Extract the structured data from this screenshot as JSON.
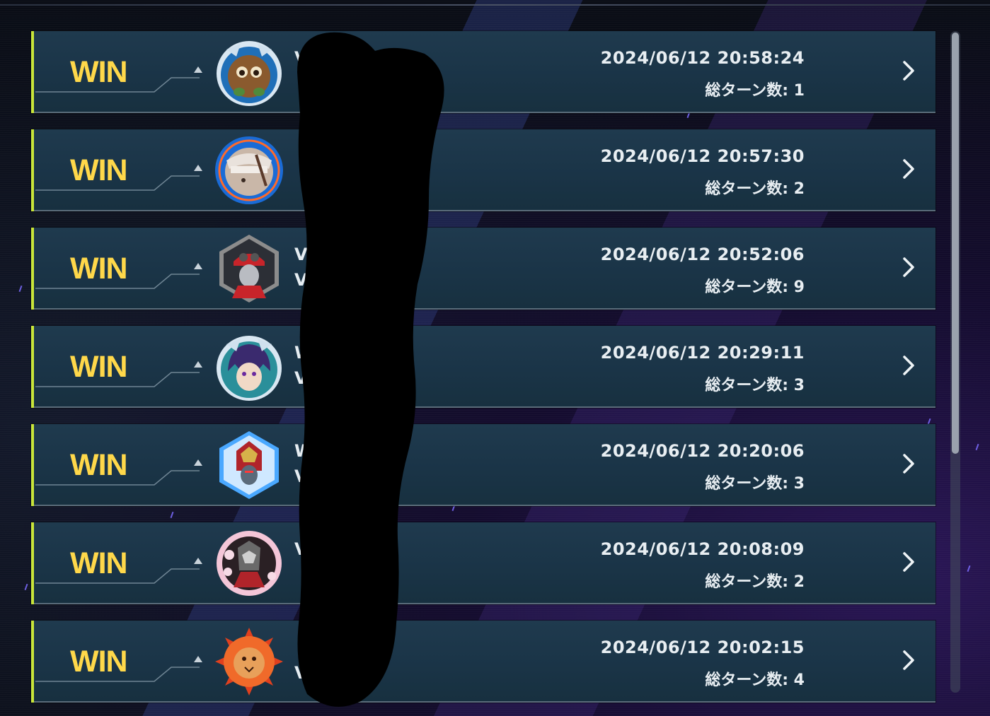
{
  "duel_history": {
    "entries": [
      {
        "result": "WIN",
        "avatar": "kuriboh-avatar",
        "name_line1": "V",
        "name_line2": "",
        "datetime": "2024/06/12 20:58:24",
        "turns": "総ターン数: 1"
      },
      {
        "result": "WIN",
        "avatar": "masked-duelist-avatar",
        "name_line1": "",
        "name_line2": "",
        "datetime": "2024/06/12 20:57:30",
        "turns": "総ターン数: 2"
      },
      {
        "result": "WIN",
        "avatar": "red-cap-duelist-avatar",
        "name_line1": "V",
        "name_line2": "V",
        "datetime": "2024/06/12 20:52:06",
        "turns": "総ターン数: 9"
      },
      {
        "result": "WIN",
        "avatar": "purple-haired-duelist-avatar",
        "name_line1": "W",
        "name_line2": "V",
        "datetime": "2024/06/12 20:29:11",
        "turns": "総ターン数: 3"
      },
      {
        "result": "WIN",
        "avatar": "armored-warrior-avatar",
        "name_line1": "W",
        "name_line2": "V",
        "datetime": "2024/06/12 20:20:06",
        "turns": "総ターン数: 3"
      },
      {
        "result": "WIN",
        "avatar": "sakura-knight-avatar",
        "name_line1": "V",
        "name_line2": "",
        "datetime": "2024/06/12 20:08:09",
        "turns": "総ターン数: 2"
      },
      {
        "result": "WIN",
        "avatar": "lion-mane-avatar",
        "name_line1": "",
        "name_line2": "V",
        "datetime": "2024/06/12 20:02:15",
        "turns": "総ターン数: 4"
      }
    ]
  },
  "colors": {
    "win_text": "#ffd84a",
    "row_accent": "#c9e63a",
    "row_background": "#1a3447"
  }
}
